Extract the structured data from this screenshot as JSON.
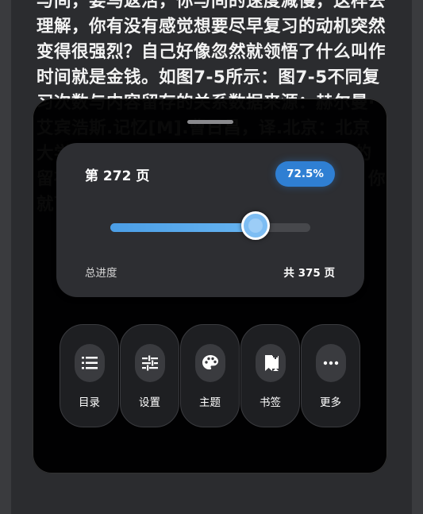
{
  "reader": {
    "text": "与间，要马返活，你与间的速度减慢，这样去理解，你有没有感觉想要尽早复习的动机突然变得很强烈？自己好像忽然就领悟了什么叫作时间就是金钱。如图7-5所示：图7-5不同复习次数与内容留存的关系数据来源：赫尔曼·艾宾浩斯.记忆[M].曹日昌，译.北京：北京大学出版社，2014.你每复习一次，记忆的留存量就会提升一点，这样重复几个周期，你就可以做到内容的长期保持。复习呢"
  },
  "progress": {
    "current_page_label": "第 272 页",
    "percent_label": "72.5%",
    "percent": 72.5,
    "caption": "总进度",
    "total_label": "共 375 页"
  },
  "actions": [
    {
      "label": "目录",
      "icon": "list-icon"
    },
    {
      "label": "设置",
      "icon": "sliders-icon"
    },
    {
      "label": "主题",
      "icon": "palette-icon"
    },
    {
      "label": "书签",
      "icon": "bookmark-icon"
    },
    {
      "label": "更多",
      "icon": "more-icon"
    }
  ],
  "colors": {
    "accent": "#2f7fd3",
    "slider_fill": "#5aa9ee",
    "panel": "#000000",
    "card": "#2d2e32"
  }
}
